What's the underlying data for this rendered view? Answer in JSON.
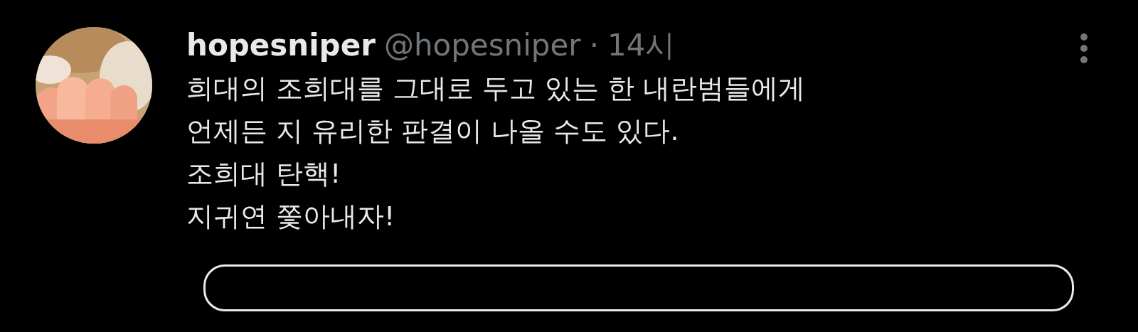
{
  "post": {
    "author": {
      "name": "hopesniper",
      "handle": "@hopesniper",
      "separator": "·",
      "time": "14시"
    },
    "lines": [
      "희대의 조희대를 그대로 두고 있는 한 내란범들에게",
      "언제든 지 유리한 판결이 나올 수도 있다.",
      "조희대 탄핵!",
      "지귀연 쫓아내자!"
    ]
  }
}
